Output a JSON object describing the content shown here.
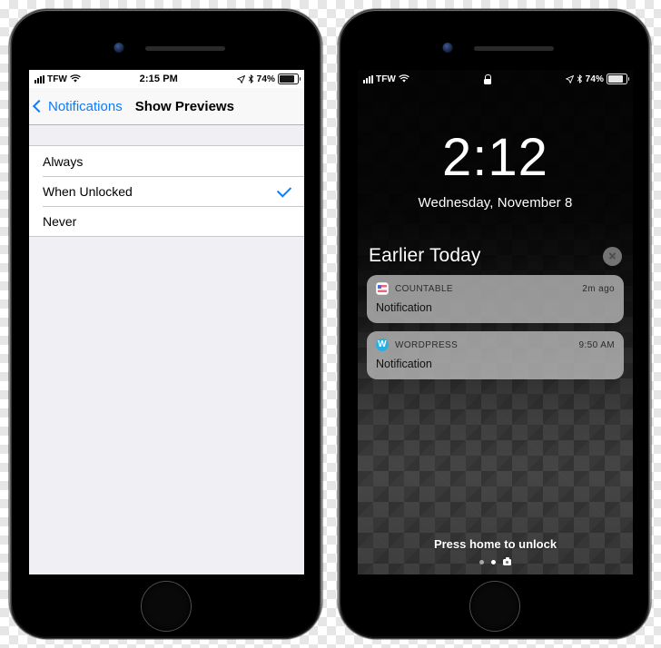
{
  "left_phone": {
    "status_bar": {
      "signal_icon": "cellular-bars-icon",
      "carrier": "TFW",
      "wifi_icon": "wifi-icon",
      "time": "2:15 PM",
      "location_icon": "location-arrow-icon",
      "bluetooth_icon": "bluetooth-icon",
      "battery_percent": "74%",
      "battery_icon": "battery-icon"
    },
    "nav_bar": {
      "back_icon": "chevron-left-icon",
      "back_label": "Notifications",
      "title": "Show Previews"
    },
    "options": [
      {
        "label": "Always",
        "selected": false
      },
      {
        "label": "When Unlocked",
        "selected": true
      },
      {
        "label": "Never",
        "selected": false
      }
    ],
    "checkmark_color": "#0a7cff",
    "accent_color": "#0a7cff"
  },
  "right_phone": {
    "status_bar": {
      "signal_icon": "cellular-bars-icon",
      "carrier": "TFW",
      "wifi_icon": "wifi-icon",
      "lock_icon": "lock-icon",
      "location_icon": "location-arrow-icon",
      "bluetooth_icon": "bluetooth-icon",
      "battery_percent": "74%",
      "battery_icon": "battery-icon"
    },
    "lock_screen": {
      "time": "2:12",
      "date": "Wednesday, November 8",
      "section_title": "Earlier Today",
      "clear_icon": "close-circle-icon",
      "notifications": [
        {
          "app": "COUNTABLE",
          "app_icon": "countable-app-icon",
          "time": "2m ago",
          "body": "Notification"
        },
        {
          "app": "WORDPRESS",
          "app_icon": "wordpress-app-icon",
          "app_icon_glyph": "W",
          "time": "9:50 AM",
          "body": "Notification"
        }
      ],
      "unlock_hint": "Press home to unlock",
      "camera_icon": "camera-icon",
      "page_dots": 2,
      "active_dot_index": 1
    }
  }
}
